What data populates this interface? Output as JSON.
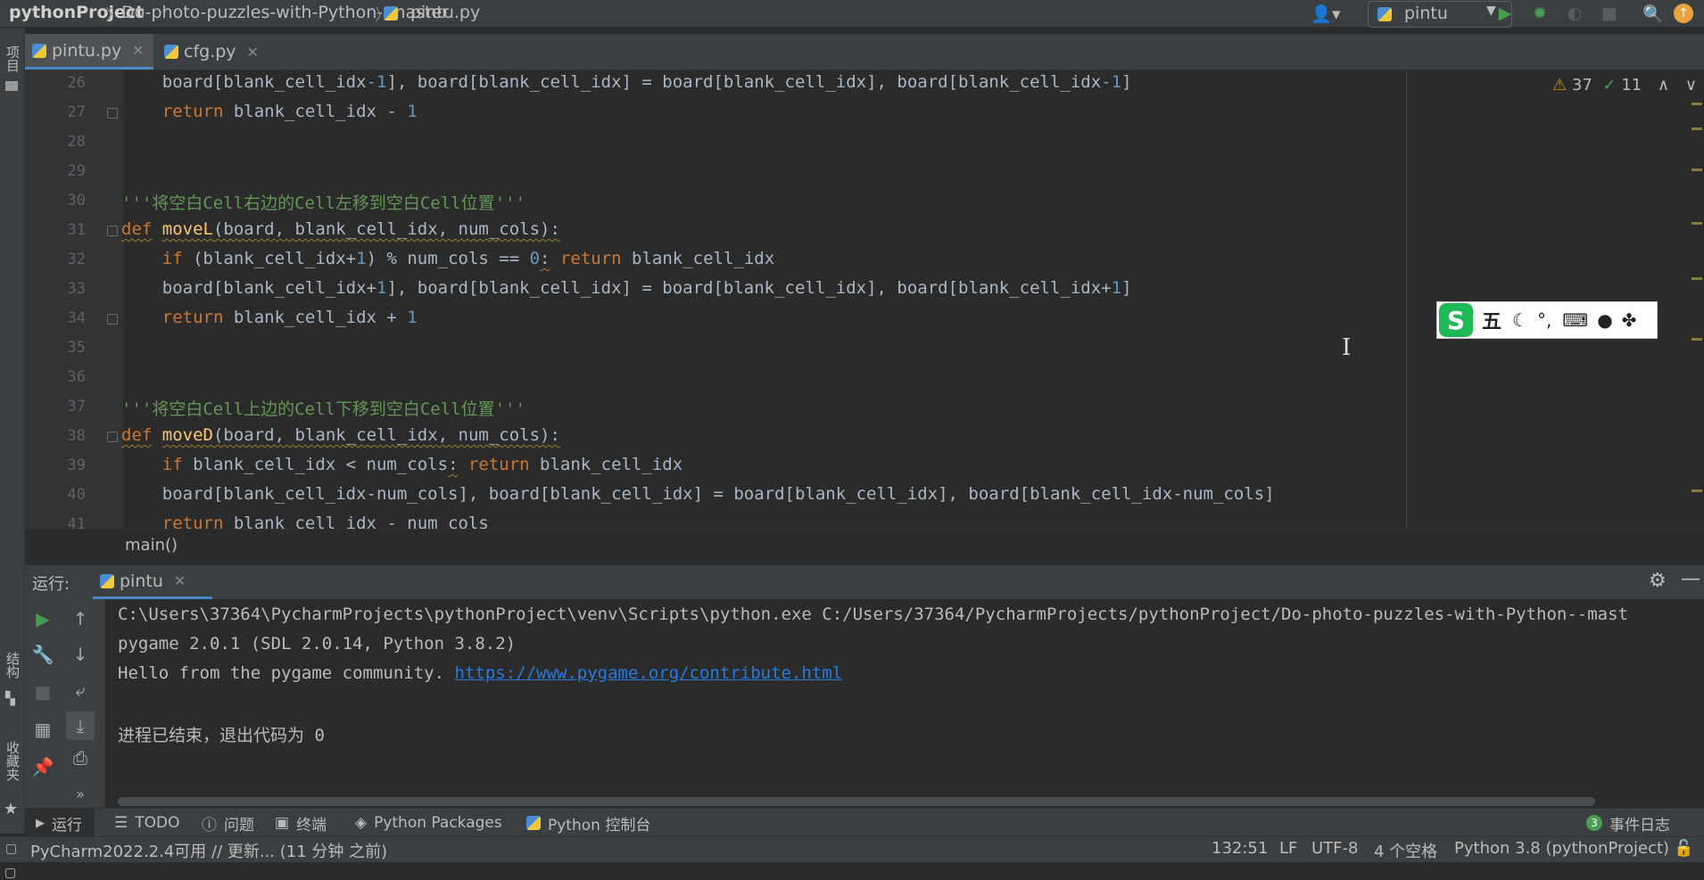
{
  "navbar": {
    "crumbs": [
      "pythonProject",
      "Do-photo-puzzles-with-Python--master",
      "pintu.py"
    ],
    "run_config": "pintu"
  },
  "left_strip": {
    "project": "项目",
    "structure": "结构",
    "favorites": "收藏夹"
  },
  "tabs": [
    {
      "label": "pintu.py",
      "active": true
    },
    {
      "label": "cfg.py",
      "active": false
    }
  ],
  "inspections": {
    "warnings": "37",
    "weak_warnings": "11"
  },
  "editor": {
    "line_numbers": [
      "26",
      "27",
      "28",
      "29",
      "30",
      "31",
      "32",
      "33",
      "34",
      "35",
      "36",
      "37",
      "38",
      "39",
      "40",
      "41"
    ],
    "lines": {
      "l26": {
        "a": "    board[blank_cell_idx",
        "b": "-1",
        "c": "], board[blank_cell_idx] = board[blank_cell_idx], board[blank_cell_idx",
        "d": "-1",
        "e": "]"
      },
      "l27": {
        "kw": "    return",
        "txt": " blank_cell_idx - ",
        "num": "1"
      },
      "l30": "'''将空白Cell右边的Cell左移到空白Cell位置'''",
      "l31": {
        "kw": "def",
        "fn": "moveL",
        "params": "(board, blank_cell_idx, num_cols):"
      },
      "l32": {
        "kw": "    if",
        "txt": " (blank_cell_idx+",
        "num1": "1",
        "txt2": ") % num_cols == ",
        "num2": "0",
        "colon": ":",
        "kw2": " return",
        "txt3": " blank_cell_idx"
      },
      "l33": {
        "a": "    board[blank_cell_idx+",
        "b": "1",
        "c": "], board[blank_cell_idx] = board[blank_cell_idx], board[blank_cell_idx+",
        "d": "1",
        "e": "]"
      },
      "l34": {
        "kw": "    return",
        "txt": " blank_cell_idx + ",
        "num": "1"
      },
      "l37": "'''将空白Cell上边的Cell下移到空白Cell位置'''",
      "l38": {
        "kw": "def",
        "fn": "moveD",
        "params": "(board, blank_cell_idx, num_cols):"
      },
      "l39": {
        "kw": "    if",
        "txt": " blank_cell_idx < num_cols",
        "colon": ":",
        "kw2": " return",
        "txt3": " blank_cell_idx"
      },
      "l40": "    board[blank_cell_idx-num_cols], board[blank_cell_idx] = board[blank_cell_idx], board[blank_cell_idx-num_cols]",
      "l41": {
        "kw": "    return",
        "txt": " blank_cell_idx - num_cols"
      }
    },
    "breadcrumb": "main()"
  },
  "ime": {
    "mode": "五",
    "icons": [
      "moon-icon",
      "punctuation-icon",
      "keyboard-icon",
      "user-icon",
      "skin-icon"
    ]
  },
  "run_panel": {
    "label": "运行:",
    "tab": "pintu",
    "output": [
      "C:\\Users\\37364\\PycharmProjects\\pythonProject\\venv\\Scripts\\python.exe C:/Users/37364/PycharmProjects/pythonProject/Do-photo-puzzles-with-Python--mast",
      "pygame 2.0.1 (SDL 2.0.14, Python 3.8.2)",
      "进程已结束，退出代码为 0"
    ],
    "hello_text": "Hello from the pygame community. ",
    "hello_link": "https://www.pygame.org/contribute.html"
  },
  "tool_tabs": [
    "运行",
    "TODO",
    "问题",
    "终端",
    "Python Packages",
    "Python 控制台"
  ],
  "event_log": {
    "count": "3",
    "label": "事件日志"
  },
  "statusbar": {
    "message": "PyCharm2022.2.4可用 // 更新... (11 分钟 之前)",
    "position": "132:51",
    "line_sep": "LF",
    "encoding": "UTF-8",
    "indent": "4 个空格",
    "interpreter": "Python 3.8 (pythonProject)"
  },
  "colors": {
    "accent": "#4a88c7",
    "run_green": "#499c54",
    "link": "#287bde"
  }
}
